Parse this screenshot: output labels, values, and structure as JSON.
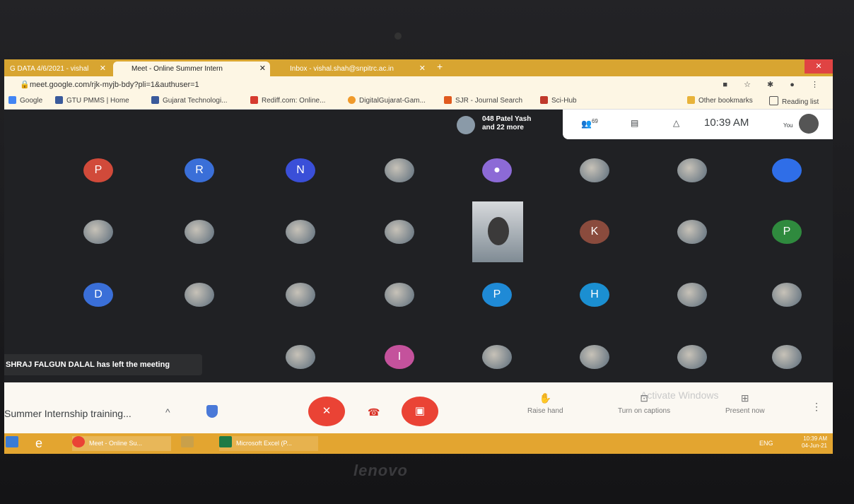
{
  "browser": {
    "tabs": [
      {
        "label": "G DATA 4/6/2021 - vishal",
        "close": "✕"
      },
      {
        "label": "Meet - Online Summer Intern",
        "close": "✕"
      },
      {
        "label": "Inbox - vishal.shah@snpitrc.ac.in",
        "close": "✕"
      }
    ],
    "new_tab": "+",
    "url": "meet.google.com/rjk-myjb-bdy?pli=1&authuser=1",
    "bookmarks": [
      {
        "label": "Google",
        "color": "#4285f4"
      },
      {
        "label": "GTU PMMS | Home",
        "color": "#3a5a9b"
      },
      {
        "label": "Gujarat Technologi...",
        "color": "#3a5a9b"
      },
      {
        "label": "Rediff.com: Online...",
        "color": "#d63b2f"
      },
      {
        "label": "DigitalGujarat-Gam...",
        "color": "#f09a2a"
      },
      {
        "label": "SJR - Journal Search",
        "color": "#e05a1e"
      },
      {
        "label": "Sci-Hub",
        "color": "#c0392b"
      }
    ],
    "other_bookmarks": "Other bookmarks",
    "reading_list": "Reading list"
  },
  "meet": {
    "presenter_line1": "048 Patel Yash",
    "presenter_line2": "and 22 more",
    "participant_count": "69",
    "clock": "10:39 AM",
    "you_label": "You",
    "toast": "SHRAJ FALGUN DALAL has left the meeting",
    "tiles_row1": [
      {
        "letter": "P",
        "color": "#d14a3a"
      },
      {
        "letter": "R",
        "color": "#3a6fd8"
      },
      {
        "letter": "N",
        "color": "#3a4fd8"
      }
    ],
    "tiles_letters": [
      {
        "letter": "K",
        "color": "#8a4b3d"
      },
      {
        "letter": "P",
        "color": "#2f8a3e"
      },
      {
        "letter": "D",
        "color": "#3a6fd8"
      },
      {
        "letter": "P",
        "color": "#1f8ad6"
      },
      {
        "letter": "H",
        "color": "#1b8fd1"
      },
      {
        "letter": "I",
        "color": "#c4529c"
      }
    ],
    "meeting_title": "Summer Internship training...",
    "raise_hand": "Raise hand",
    "captions": "Turn on captions",
    "present": "Present now",
    "watermark": "Activate Windows"
  },
  "taskbar": {
    "items": [
      {
        "label": "Meet - Online Su...",
        "color": "#ea4335"
      },
      {
        "label": "",
        "color": "#c9a04a"
      },
      {
        "label": "Microsoft Excel (P...",
        "color": "#1e7a45"
      }
    ],
    "lang": "ENG",
    "time": "10:39 AM",
    "date": "04-Jun-21"
  },
  "brand": "lenovo"
}
